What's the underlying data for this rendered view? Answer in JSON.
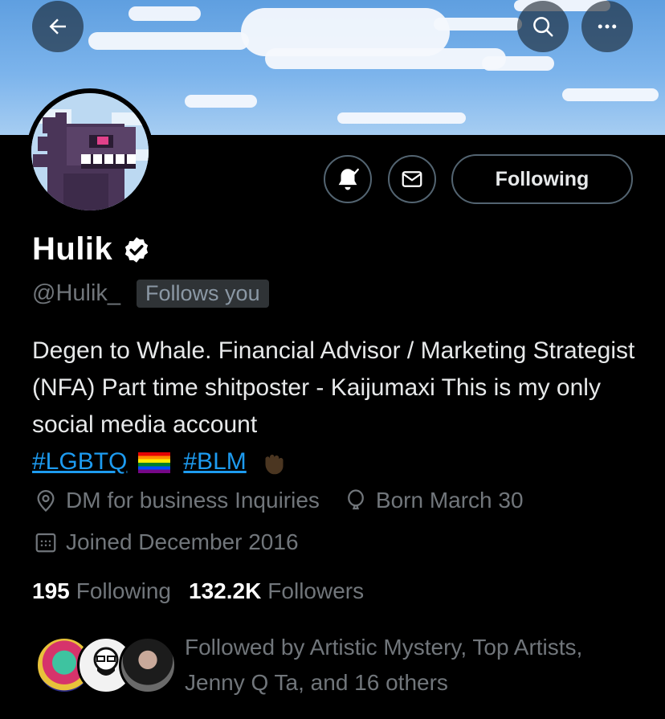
{
  "header": {
    "back_icon": "arrow-left-icon",
    "search_icon": "search-icon",
    "more_icon": "more-horizontal-icon"
  },
  "profile": {
    "display_name": "Hulik",
    "handle": "@Hulik_",
    "follows_you_badge": "Follows you",
    "following_button": "Following",
    "bio_text": "Degen to Whale. Financial Advisor / Marketing Strategist (NFA) Part time shitposter - Kaijumaxi This is my only social media account",
    "hashtags": [
      "#LGBTQ",
      "#BLM"
    ],
    "location": "DM for business Inquiries",
    "birthday": "Born March 30",
    "joined": "Joined December 2016",
    "following_count": "195",
    "following_label": "Following",
    "followers_count": "132.2K",
    "followers_label": "Followers",
    "followed_by": "Followed by Artistic Mystery, Top Artists, Jenny Q Ta, and 16 others"
  },
  "colors": {
    "background": "#000000",
    "text_primary": "#e7e9ea",
    "text_secondary": "#71767b",
    "accent_link": "#1d9bf0",
    "banner_sky": "#7cb4ec"
  }
}
